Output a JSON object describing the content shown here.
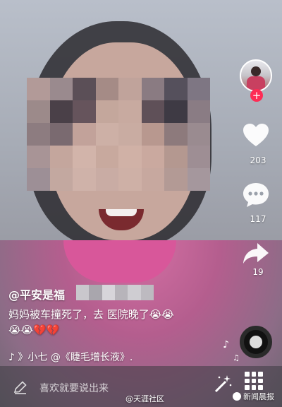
{
  "video": {
    "author": {
      "handle": "@平安是福"
    },
    "caption_line1": "妈妈被车撞死了，去 医院晚了",
    "caption_emojis_line1": "😭😭",
    "caption_emojis_line2": "😭😭💔💔",
    "music_prefix": "♪",
    "music_text": "》小七    @《睫毛增长液》."
  },
  "rail": {
    "follow_label": "+",
    "like_count": "203",
    "comment_count": "117",
    "share_count": "19"
  },
  "bottom": {
    "comment_placeholder": "喜欢就要说出来",
    "watermark_left": "@天涯社区",
    "watermark_right": "新闻晨报"
  },
  "colors": {
    "accent": "#fe2c55",
    "text": "#ffffff"
  },
  "icons": {
    "like": "heart-icon",
    "comment": "speech-bubble-icon",
    "share": "share-arrow-icon",
    "music_disc": "music-disc-icon",
    "comment_edit": "pencil-icon",
    "effects": "magic-wand-icon",
    "more": "grid-icon"
  }
}
